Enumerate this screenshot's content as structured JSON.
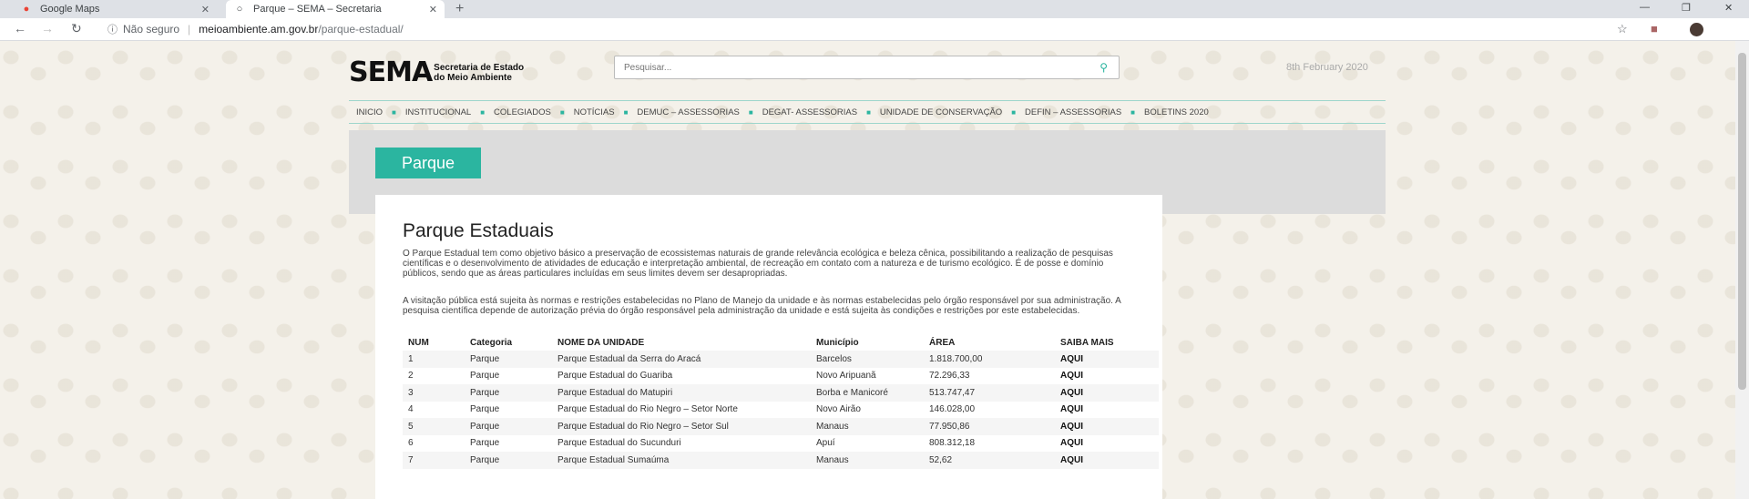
{
  "browser": {
    "tabs": [
      {
        "title": "Google Maps",
        "icon": "maps-pin-icon"
      },
      {
        "title": "Parque – SEMA – Secretaria",
        "icon": "globe-icon"
      }
    ],
    "security": "Não seguro",
    "url_host": "meioambiente.am.gov.br",
    "url_path": "/parque-estadual/"
  },
  "header": {
    "logo_big": "SEMA",
    "logo_small_line1": "Secretaria de Estado",
    "logo_small_line2": "do Meio Ambiente",
    "search_placeholder": "Pesquisar...",
    "date": "8th February 2020"
  },
  "menu": [
    "INICIO",
    "INSTITUCIONAL",
    "COLEGIADOS",
    "NOTÍCIAS",
    "DEMUC – ASSESSORIAS",
    "DEGAT- ASSESSORIAS",
    "UNIDADE DE CONSERVAÇÃO",
    "DEFIN – ASSESSORIAS",
    "BOLETINS 2020"
  ],
  "hero": {
    "label": "Parque"
  },
  "article": {
    "title": "Parque Estaduais",
    "para1": "O Parque Estadual tem como objetivo básico a preservação de ecossistemas naturais de grande relevância ecológica e beleza cênica, possibilitando a realização de pesquisas científicas e o desenvolvimento de atividades de educação e interpretação ambiental, de recreação em contato com a natureza e de turismo ecológico. É de posse e domínio públicos, sendo que as áreas particulares incluídas em seus limites devem ser desapropriadas.",
    "para2": "A visitação pública está sujeita às normas e restrições estabelecidas no Plano de Manejo da unidade e às normas estabelecidas pelo órgão responsável por sua administração. A pesquisa científica depende de autorização prévia do órgão responsável pela administração da unidade e está sujeita às condições e restrições por este estabelecidas."
  },
  "table": {
    "headers": [
      "NUM",
      "Categoria",
      "NOME DA UNIDADE",
      "Município",
      "ÁREA",
      "SAIBA MAIS"
    ],
    "rows": [
      [
        "1",
        "Parque",
        "Parque Estadual da Serra do Aracá",
        "Barcelos",
        "1.818.700,00",
        "AQUI"
      ],
      [
        "2",
        "Parque",
        "Parque Estadual do Guariba",
        "Novo Aripuanã",
        "72.296,33",
        "AQUI"
      ],
      [
        "3",
        "Parque",
        "Parque Estadual do Matupiri",
        "Borba e Manicoré",
        "513.747,47",
        "AQUI"
      ],
      [
        "4",
        "Parque",
        "Parque Estadual do Rio Negro – Setor Norte",
        "Novo Airão",
        "146.028,00",
        "AQUI"
      ],
      [
        "5",
        "Parque",
        "Parque Estadual do Rio Negro – Setor Sul",
        "Manaus",
        "77.950,86",
        "AQUI"
      ],
      [
        "6",
        "Parque",
        "Parque Estadual do Sucunduri",
        "Apuí",
        "808.312,18",
        "AQUI"
      ],
      [
        "7",
        "Parque",
        "Parque Estadual Sumaúma",
        "Manaus",
        "52,62",
        "AQUI"
      ]
    ]
  },
  "colors": {
    "accent": "#2bb5a0",
    "hero_bg": "#dcdcdc"
  }
}
